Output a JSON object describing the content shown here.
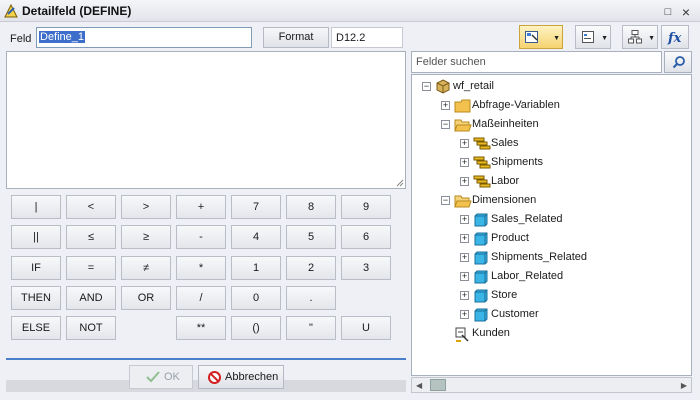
{
  "window": {
    "title": "Detailfeld (DEFINE)",
    "buttons": {
      "restore": "□",
      "close": "×"
    }
  },
  "field": {
    "label": "Feld",
    "value": "Define_1"
  },
  "format": {
    "button_label": "Format",
    "value": "D12.2"
  },
  "toolbar": [
    {
      "name": "field-list-view-icon",
      "active": true
    },
    {
      "name": "list-view-icon",
      "active": false
    },
    {
      "name": "tree-view-icon",
      "active": false
    },
    {
      "name": "function-icon",
      "active": false,
      "glyph": "fx"
    }
  ],
  "expression": {
    "value": ""
  },
  "keypad": {
    "rows": [
      [
        "|",
        "<",
        ">",
        "+",
        "7",
        "8",
        "9"
      ],
      [
        "||",
        "≤",
        "≥",
        "-",
        "4",
        "5",
        "6"
      ],
      [
        "IF",
        "=",
        "≠",
        "*",
        "1",
        "2",
        "3"
      ],
      [
        "THEN",
        "AND",
        "OR",
        "/",
        "0",
        ".",
        ""
      ],
      [
        "ELSE",
        "NOT",
        "",
        "**",
        "()",
        "\"",
        "U"
      ]
    ]
  },
  "footer": {
    "ok_label": "OK",
    "cancel_label": "Abbrechen"
  },
  "search": {
    "placeholder": "Felder suchen"
  },
  "tree": {
    "root": "wf_retail",
    "items": [
      {
        "label": "wf_retail",
        "level": 0,
        "icon": "cube-icon",
        "toggle": "−"
      },
      {
        "label": "Abfrage-Variablen",
        "level": 1,
        "icon": "folder-icon",
        "toggle": "+"
      },
      {
        "label": "Maßeinheiten",
        "level": 1,
        "icon": "folder-open-icon",
        "toggle": "−"
      },
      {
        "label": "Sales",
        "level": 2,
        "icon": "measure-group-icon",
        "toggle": "+"
      },
      {
        "label": "Shipments",
        "level": 2,
        "icon": "measure-group-icon",
        "toggle": "+"
      },
      {
        "label": "Labor",
        "level": 2,
        "icon": "measure-group-icon",
        "toggle": "+"
      },
      {
        "label": "Dimensionen",
        "level": 1,
        "icon": "folder-open-icon",
        "toggle": "−"
      },
      {
        "label": "Sales_Related",
        "level": 2,
        "icon": "dimension-icon",
        "toggle": "+"
      },
      {
        "label": "Product",
        "level": 2,
        "icon": "dimension-icon",
        "toggle": "+"
      },
      {
        "label": "Shipments_Related",
        "level": 2,
        "icon": "dimension-icon",
        "toggle": "+"
      },
      {
        "label": "Labor_Related",
        "level": 2,
        "icon": "dimension-icon",
        "toggle": "+"
      },
      {
        "label": "Store",
        "level": 2,
        "icon": "dimension-icon",
        "toggle": "+"
      },
      {
        "label": "Customer",
        "level": 2,
        "icon": "dimension-icon",
        "toggle": "+"
      },
      {
        "label": "Kunden",
        "level": 1,
        "icon": "define-field-icon",
        "toggle": ""
      }
    ]
  },
  "colors": {
    "accent": "#4a7fc9",
    "selection": "#3d6ec9",
    "folder": "#f2c14e",
    "dimension": "#3bb4e6",
    "measure": "#e8b923"
  }
}
